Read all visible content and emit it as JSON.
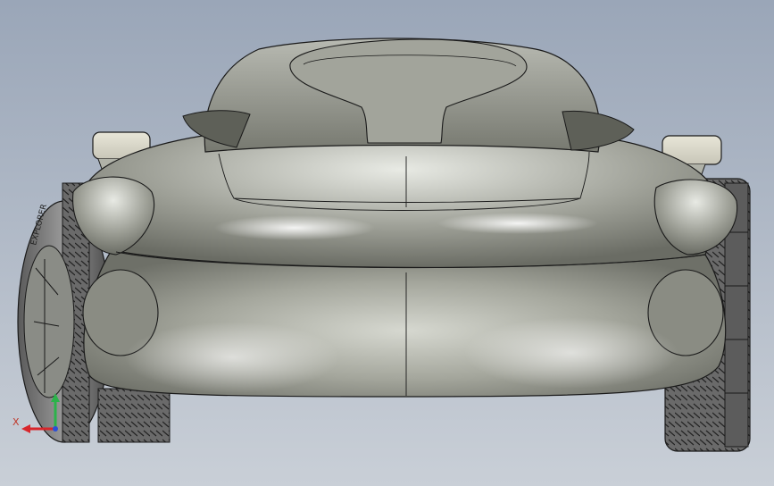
{
  "viewport": {
    "background_top": "#9aa6b8",
    "background_bottom": "#c9cfd7"
  },
  "model": {
    "body_color": "#8f9188",
    "highlight_color": "#eef0ea",
    "edge_color": "#1a1a1a",
    "tire_color": "#3a3a3a",
    "tread_text": "EXPLORER"
  },
  "axis_triad": {
    "x_label": "X",
    "x_color": "#d8262b",
    "y_color": "#2bb34a",
    "z_color": "#2b4fd8"
  }
}
